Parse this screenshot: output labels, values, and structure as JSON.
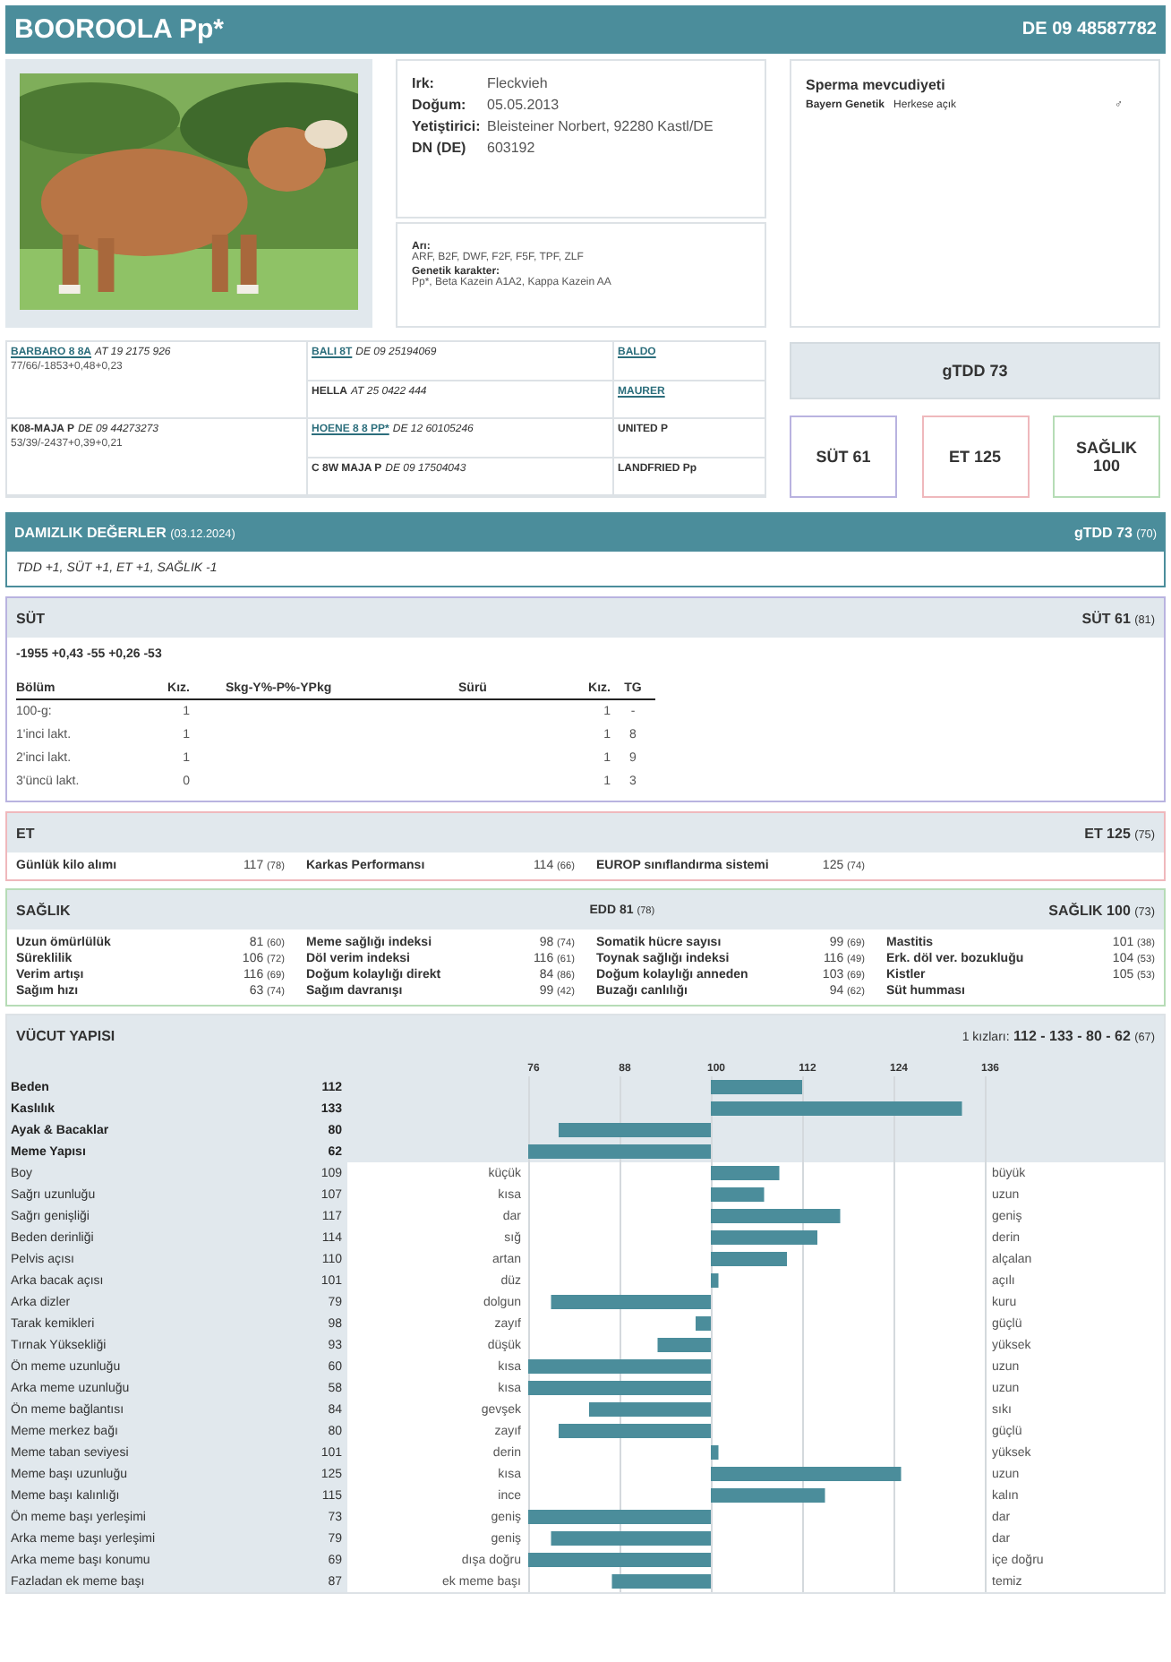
{
  "header": {
    "title": "BOOROOLA Pp*",
    "id": "DE 09 48587782"
  },
  "info": {
    "fields": [
      {
        "label": "Irk:",
        "value": "Fleckvieh"
      },
      {
        "label": "Doğum:",
        "value": "05.05.2013"
      },
      {
        "label": "Yetiştirici:",
        "value": "Bleisteiner Norbert, 92280 Kastl/DE"
      },
      {
        "label": "DN (DE)",
        "value": "603192"
      }
    ],
    "extra": [
      {
        "label": "Arı:",
        "value": "ARF, B2F, DWF, F2F, F5F, TPF, ZLF"
      },
      {
        "label": "Genetik karakter:",
        "value": "Pp*, Beta Kazein A1A2, Kappa Kazein AA"
      }
    ]
  },
  "semen": {
    "title": "Sperma mevcudiyeti",
    "rows": [
      {
        "station": "Bayern Genetik",
        "access": "Herkese açık",
        "symbol": "♂"
      }
    ]
  },
  "pedigree": [
    {
      "name": "BARBARO 8 8A",
      "link": true,
      "reg": "AT 19 2175 926",
      "stats": "77/66/-1853+0,48+0,23",
      "parents": [
        {
          "name": "BALI 8T",
          "link": true,
          "reg": "DE 09 25194069",
          "sire": {
            "name": "BALDO",
            "link": true
          }
        },
        {
          "name": "HELLA",
          "link": false,
          "reg": "AT 25 0422 444",
          "sire": {
            "name": "MAURER",
            "link": true
          }
        }
      ]
    },
    {
      "name": "K08-MAJA P",
      "link": false,
      "reg": "DE 09 44273273",
      "stats": "53/39/-2437+0,39+0,21",
      "parents": [
        {
          "name": "HOENE 8 8 PP*",
          "link": true,
          "reg": "DE 12 60105246",
          "sire": {
            "name": "UNITED P",
            "link": false
          }
        },
        {
          "name": "C 8W MAJA P",
          "link": false,
          "reg": "DE 09 17504043",
          "sire": {
            "name": "LANDFRIED Pp",
            "link": false
          }
        }
      ]
    }
  ],
  "indices": {
    "total": "gTDD 73",
    "boxes": [
      {
        "label": "SÜT 61",
        "kind": "milk"
      },
      {
        "label": "ET 125",
        "kind": "beef"
      },
      {
        "label": "SAĞLIK 100",
        "kind": "health"
      }
    ]
  },
  "breeding": {
    "title": "DAMIZLIK DEĞERLER",
    "date": "(03.12.2024)",
    "score": "gTDD 73",
    "reliability": "(70)",
    "note": "TDD +1, SÜT +1, ET +1, SAĞLIK -1"
  },
  "milk": {
    "title": "SÜT",
    "score": "SÜT 61",
    "reliability": "(81)",
    "summary": "-1955 +0,43 -55 +0,26 -53",
    "columns": [
      "Bölüm",
      "Kız.",
      "Skg-Y%-P%-YPkg",
      "Sürü",
      "Kız.",
      "TG"
    ],
    "rows": [
      {
        "section": "100-g:",
        "daughters": "1",
        "herd_daughters": "1",
        "tg": "-"
      },
      {
        "section": "1'inci lakt.",
        "daughters": "1",
        "herd_daughters": "1",
        "tg": "8"
      },
      {
        "section": "2'inci lakt.",
        "daughters": "1",
        "herd_daughters": "1",
        "tg": "9"
      },
      {
        "section": "3'üncü lakt.",
        "daughters": "0",
        "herd_daughters": "1",
        "tg": "3"
      }
    ]
  },
  "beef": {
    "title": "ET",
    "score": "ET 125",
    "reliability": "(75)",
    "traits": [
      {
        "label": "Günlük kilo alımı",
        "value": "117",
        "reliability": "(78)"
      },
      {
        "label": "Karkas Performansı",
        "value": "114",
        "reliability": "(66)"
      },
      {
        "label": "EUROP sınıflandırma sistemi",
        "value": "125",
        "reliability": "(74)"
      }
    ]
  },
  "health": {
    "title": "SAĞLIK",
    "edd": "EDD 81",
    "edd_reliability": "(78)",
    "score": "SAĞLIK 100",
    "reliability": "(73)",
    "traits": [
      {
        "label": "Uzun ömürlülük",
        "value": "81",
        "reliability": "(60)"
      },
      {
        "label": "Meme sağlığı indeksi",
        "value": "98",
        "reliability": "(74)"
      },
      {
        "label": "Somatik hücre sayısı",
        "value": "99",
        "reliability": "(69)"
      },
      {
        "label": "Mastitis",
        "value": "101",
        "reliability": "(38)"
      },
      {
        "label": "Süreklilik",
        "value": "106",
        "reliability": "(72)"
      },
      {
        "label": "Döl verim indeksi",
        "value": "116",
        "reliability": "(61)"
      },
      {
        "label": "Toynak sağlığı indeksi",
        "value": "116",
        "reliability": "(49)"
      },
      {
        "label": "Erk. döl ver. bozukluğu",
        "value": "104",
        "reliability": "(53)"
      },
      {
        "label": "Verim artışı",
        "value": "116",
        "reliability": "(69)"
      },
      {
        "label": "Doğum kolaylığı direkt",
        "value": "84",
        "reliability": "(86)"
      },
      {
        "label": "Doğum kolaylığı anneden",
        "value": "103",
        "reliability": "(69)"
      },
      {
        "label": "Kistler",
        "value": "105",
        "reliability": "(53)"
      },
      {
        "label": "Sağım hızı",
        "value": "63",
        "reliability": "(74)"
      },
      {
        "label": "Sağım davranışı",
        "value": "99",
        "reliability": "(42)"
      },
      {
        "label": "Buzağı canlılığı",
        "value": "94",
        "reliability": "(62)"
      },
      {
        "label": "Süt humması"
      }
    ]
  },
  "conformation": {
    "title": "VÜCUT YAPISI",
    "summary_label": "1 kızları:",
    "summary": "112 - 133 - 80 - 62",
    "reliability": "(67)",
    "scale": [
      "76",
      "88",
      "100",
      "112",
      "124",
      "136"
    ],
    "rows": [
      {
        "kind": "summary",
        "label": "Beden",
        "value": "112"
      },
      {
        "kind": "summary",
        "label": "Kaslılık",
        "value": "133"
      },
      {
        "kind": "summary",
        "label": "Ayak & Bacaklar",
        "value": "80"
      },
      {
        "kind": "summary",
        "label": "Meme Yapısı",
        "value": "62"
      },
      {
        "kind": "trait",
        "label": "Boy",
        "value": "109",
        "low": "küçük",
        "high": "büyük"
      },
      {
        "kind": "trait",
        "label": "Sağrı uzunluğu",
        "value": "107",
        "low": "kısa",
        "high": "uzun"
      },
      {
        "kind": "trait",
        "label": "Sağrı genişliği",
        "value": "117",
        "low": "dar",
        "high": "geniş"
      },
      {
        "kind": "trait",
        "label": "Beden derinliği",
        "value": "114",
        "low": "sığ",
        "high": "derin"
      },
      {
        "kind": "trait",
        "label": "Pelvis açısı",
        "value": "110",
        "low": "artan",
        "high": "alçalan"
      },
      {
        "kind": "trait",
        "label": "Arka bacak açısı",
        "value": "101",
        "low": "düz",
        "high": "açılı"
      },
      {
        "kind": "trait",
        "label": "Arka dizler",
        "value": "79",
        "low": "dolgun",
        "high": "kuru"
      },
      {
        "kind": "trait",
        "label": "Tarak kemikleri",
        "value": "98",
        "low": "zayıf",
        "high": "güçlü"
      },
      {
        "kind": "trait",
        "label": "Tırnak Yüksekliği",
        "value": "93",
        "low": "düşük",
        "high": "yüksek"
      },
      {
        "kind": "trait",
        "label": "Ön meme uzunluğu",
        "value": "60",
        "low": "kısa",
        "high": "uzun"
      },
      {
        "kind": "trait",
        "label": "Arka meme uzunluğu",
        "value": "58",
        "low": "kısa",
        "high": "uzun"
      },
      {
        "kind": "trait",
        "label": "Ön meme bağlantısı",
        "value": "84",
        "low": "gevşek",
        "high": "sıkı"
      },
      {
        "kind": "trait",
        "label": "Meme merkez bağı",
        "value": "80",
        "low": "zayıf",
        "high": "güçlü"
      },
      {
        "kind": "trait",
        "label": "Meme taban seviyesi",
        "value": "101",
        "low": "derin",
        "high": "yüksek"
      },
      {
        "kind": "trait",
        "label": "Meme başı uzunluğu",
        "value": "125",
        "low": "kısa",
        "high": "uzun"
      },
      {
        "kind": "trait",
        "label": "Meme başı kalınlığı",
        "value": "115",
        "low": "ince",
        "high": "kalın"
      },
      {
        "kind": "trait",
        "label": "Ön meme başı yerleşimi",
        "value": "73",
        "low": "geniş",
        "high": "dar"
      },
      {
        "kind": "trait",
        "label": "Arka meme başı yerleşimi",
        "value": "79",
        "low": "geniş",
        "high": "dar"
      },
      {
        "kind": "trait",
        "label": "Arka meme başı konumu",
        "value": "69",
        "low": "dışa doğru",
        "high": "içe doğru"
      },
      {
        "kind": "trait",
        "label": "Fazladan ek meme başı",
        "value": "87",
        "low": "ek meme başı",
        "high": "temiz"
      }
    ]
  }
}
